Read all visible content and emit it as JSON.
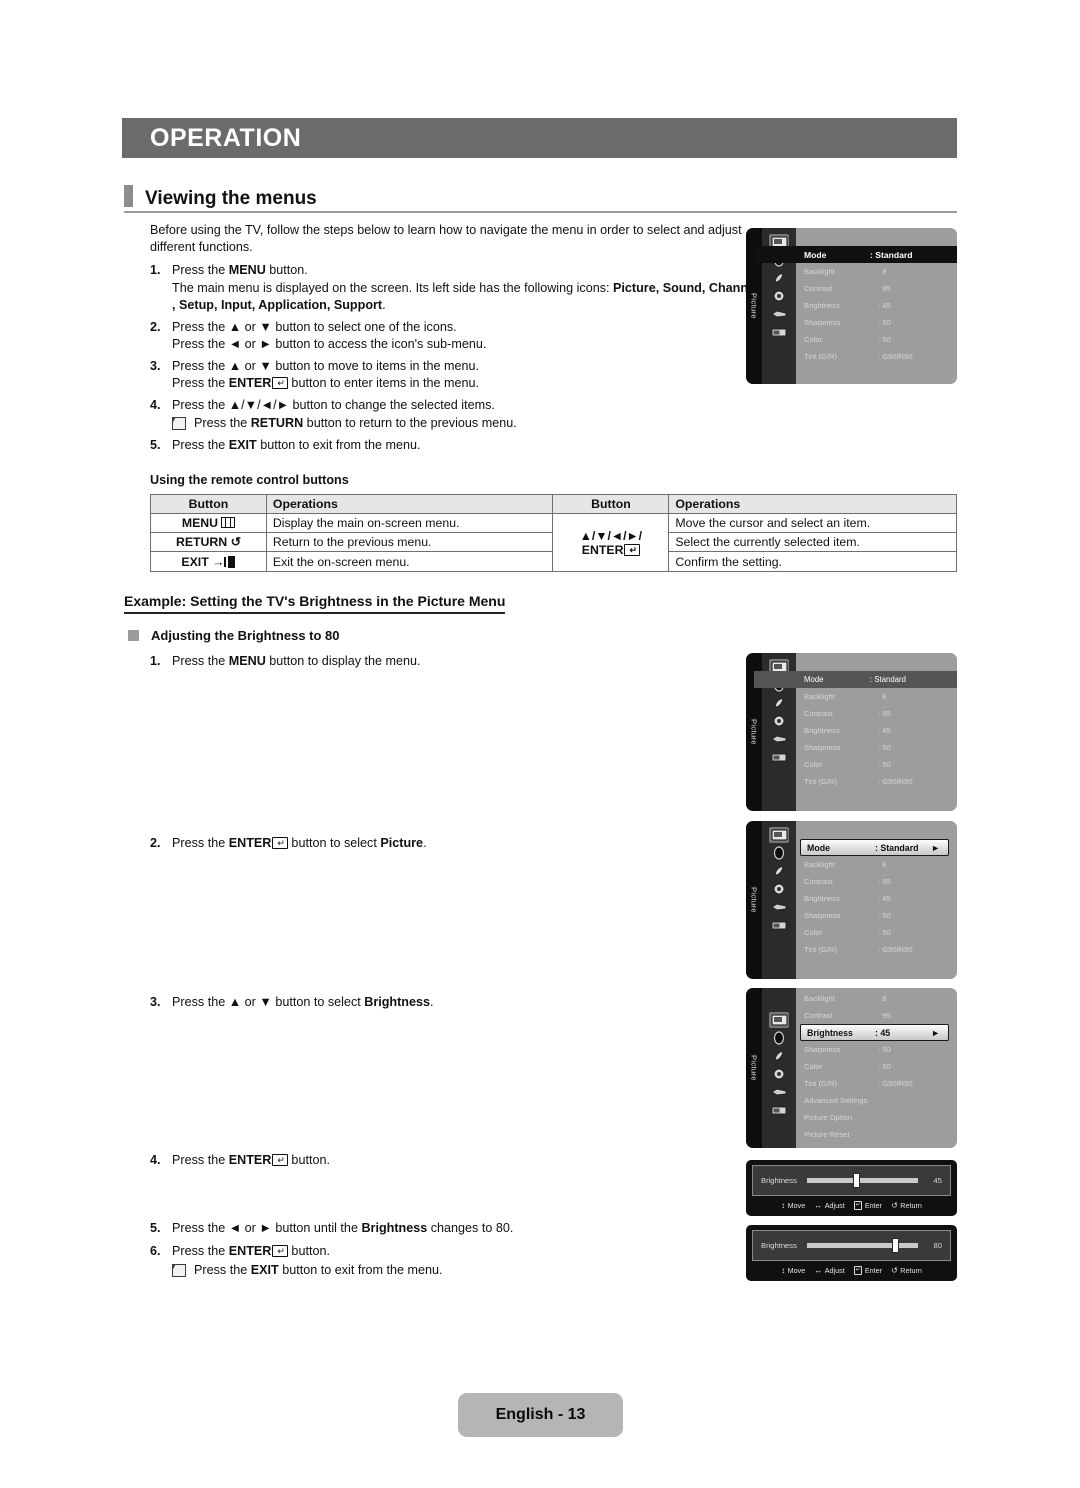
{
  "chapter": {
    "title": "OPERATION"
  },
  "section": {
    "title": "Viewing the menus"
  },
  "intro": "Before using the TV, follow the steps below to learn how to navigate the menu in order to select and adjust different functions.",
  "steps": [
    {
      "num": "1.",
      "line1_pre": "Press the ",
      "line1_bold": "MENU",
      "line1_post": " button.",
      "line2_pre": "The main menu is displayed on the screen. Its left side has the following icons: ",
      "line2_bold": "Picture, Sound, Channel , Setup, Input, Application, Support",
      "line2_post": "."
    },
    {
      "num": "2.",
      "line1": "Press the ▲ or ▼ button to select one of the icons.",
      "line2": "Press the ◄ or ► button to access the icon's sub-menu."
    },
    {
      "num": "3.",
      "line1": "Press the ▲ or ▼ button to move to items in the menu.",
      "line2_pre": "Press the ",
      "line2_bold": "ENTER",
      "line2_post": " button to enter items in the menu."
    },
    {
      "num": "4.",
      "line1": "Press the ▲/▼/◄/► button to change the selected items.",
      "note_pre": "Press the ",
      "note_bold": "RETURN",
      "note_post": " button to return to the previous menu."
    },
    {
      "num": "5.",
      "line1_pre": "Press the ",
      "line1_bold": "EXIT",
      "line1_post": " button to exit from the menu."
    }
  ],
  "remote_table": {
    "subtitle": "Using the remote control buttons",
    "headers": [
      "Button",
      "Operations",
      "Button",
      "Operations"
    ],
    "left_rows": [
      {
        "button": "MENU",
        "glyph": "menu-icon",
        "operation": "Display the main on-screen menu."
      },
      {
        "button": "RETURN",
        "glyph": "return-arrow-icon",
        "operation": "Return to the previous menu."
      },
      {
        "button": "EXIT",
        "glyph": "exit-door-icon",
        "operation": "Exit the on-screen menu."
      }
    ],
    "right_button_line1": "▲/▼/◄/►/",
    "right_button_line2": "ENTER",
    "right_rows": [
      "Move the cursor and select an item.",
      "Select the currently selected item.",
      "Confirm the setting."
    ]
  },
  "example": {
    "heading": "Example: Setting the TV's Brightness in the Picture Menu",
    "subheading": "Adjusting the Brightness to 80",
    "steps": [
      {
        "num": "1.",
        "pre": "Press the ",
        "bold": "MENU",
        "post": " button to display the menu."
      },
      {
        "num": "2.",
        "pre": "Press the ",
        "bold": "ENTER",
        "mid": " button to select ",
        "bold2": "Picture",
        "post": "."
      },
      {
        "num": "3.",
        "pre": "Press the ▲ or ▼ button to select ",
        "bold2": "Brightness",
        "post": "."
      },
      {
        "num": "4.",
        "pre": "Press the ",
        "bold": "ENTER",
        "post": " button."
      },
      {
        "num": "5.",
        "pre": "Press the ◄ or ► button until the ",
        "bold2": "Brightness",
        "post": " changes to 80."
      },
      {
        "num": "6.",
        "pre": "Press the ",
        "bold": "ENTER",
        "post": " button.",
        "note_pre": "Press the ",
        "note_bold": "EXIT",
        "note_post": " button to exit from the menu."
      }
    ]
  },
  "osd": {
    "rail_label": "Picture",
    "icons": [
      "picture-mode-icon",
      "backlight-icon",
      "contrast-icon",
      "settings-gear-icon",
      "color-icon",
      "tint-icon"
    ],
    "panel1": {
      "rows": [
        {
          "label": "Mode",
          "value": ": Standard",
          "state": "inverted"
        },
        {
          "label": "Backlight",
          "value": ": 8",
          "state": "normal"
        },
        {
          "label": "Contrast",
          "value": ": 95",
          "state": "normal"
        },
        {
          "label": "Brightness",
          "value": ": 45",
          "state": "normal"
        },
        {
          "label": "Sharpness",
          "value": ": 50",
          "state": "normal"
        },
        {
          "label": "Color",
          "value": ": 50",
          "state": "normal"
        },
        {
          "label": "Tint (G/R)",
          "value": ": G50/R50",
          "state": "normal"
        }
      ]
    },
    "panel2": {
      "rows": [
        {
          "label": "Mode",
          "value": ": Standard",
          "state": "inverted"
        },
        {
          "label": "Backlight",
          "value": ": 8",
          "state": "normal"
        },
        {
          "label": "Contrast",
          "value": ": 95",
          "state": "normal"
        },
        {
          "label": "Brightness",
          "value": ": 45",
          "state": "normal"
        },
        {
          "label": "Sharpness",
          "value": ": 50",
          "state": "normal"
        },
        {
          "label": "Color",
          "value": ": 50",
          "state": "normal"
        },
        {
          "label": "Tint (G/R)",
          "value": ": G50/R50",
          "state": "normal"
        }
      ]
    },
    "panel3": {
      "rows": [
        {
          "label": "Mode",
          "value": ": Standard",
          "state": "highlighted",
          "arrow": "►"
        },
        {
          "label": "Backlight",
          "value": ": 8",
          "state": "normal"
        },
        {
          "label": "Contrast",
          "value": ": 95",
          "state": "normal"
        },
        {
          "label": "Brightness",
          "value": ": 45",
          "state": "normal"
        },
        {
          "label": "Sharpness",
          "value": ": 50",
          "state": "normal"
        },
        {
          "label": "Color",
          "value": ": 50",
          "state": "normal"
        },
        {
          "label": "Tint (G/R)",
          "value": ": G50/R50",
          "state": "normal"
        }
      ]
    },
    "panel4": {
      "rows": [
        {
          "label": "Backlight",
          "value": ": 8",
          "state": "normal"
        },
        {
          "label": "Contrast",
          "value": ": 95",
          "state": "normal"
        },
        {
          "label": "Brightness",
          "value": ": 45",
          "state": "highlighted",
          "arrow": "►"
        },
        {
          "label": "Sharpness",
          "value": ": 50",
          "state": "normal"
        },
        {
          "label": "Color",
          "value": ": 50",
          "state": "normal"
        },
        {
          "label": "Tint (G/R)",
          "value": ": G50/R50",
          "state": "normal"
        },
        {
          "label": "Advanced Settings",
          "value": "",
          "state": "normal"
        },
        {
          "label": "Picture Option",
          "value": "",
          "state": "normal"
        },
        {
          "label": "Picture Reset",
          "value": "",
          "state": "normal"
        }
      ]
    },
    "slider1": {
      "label": "Brightness",
      "value": "45",
      "percent": 45
    },
    "slider2": {
      "label": "Brightness",
      "value": "80",
      "percent": 80
    },
    "slider_footer": [
      {
        "glyph": "⬍",
        "label": "Move"
      },
      {
        "glyph": "⬌",
        "label": "Adjust"
      },
      {
        "glyph": "enter-key-icon",
        "label": "Enter"
      },
      {
        "glyph": "↺",
        "label": "Return"
      }
    ]
  },
  "footer": {
    "page_label": "English - 13"
  }
}
